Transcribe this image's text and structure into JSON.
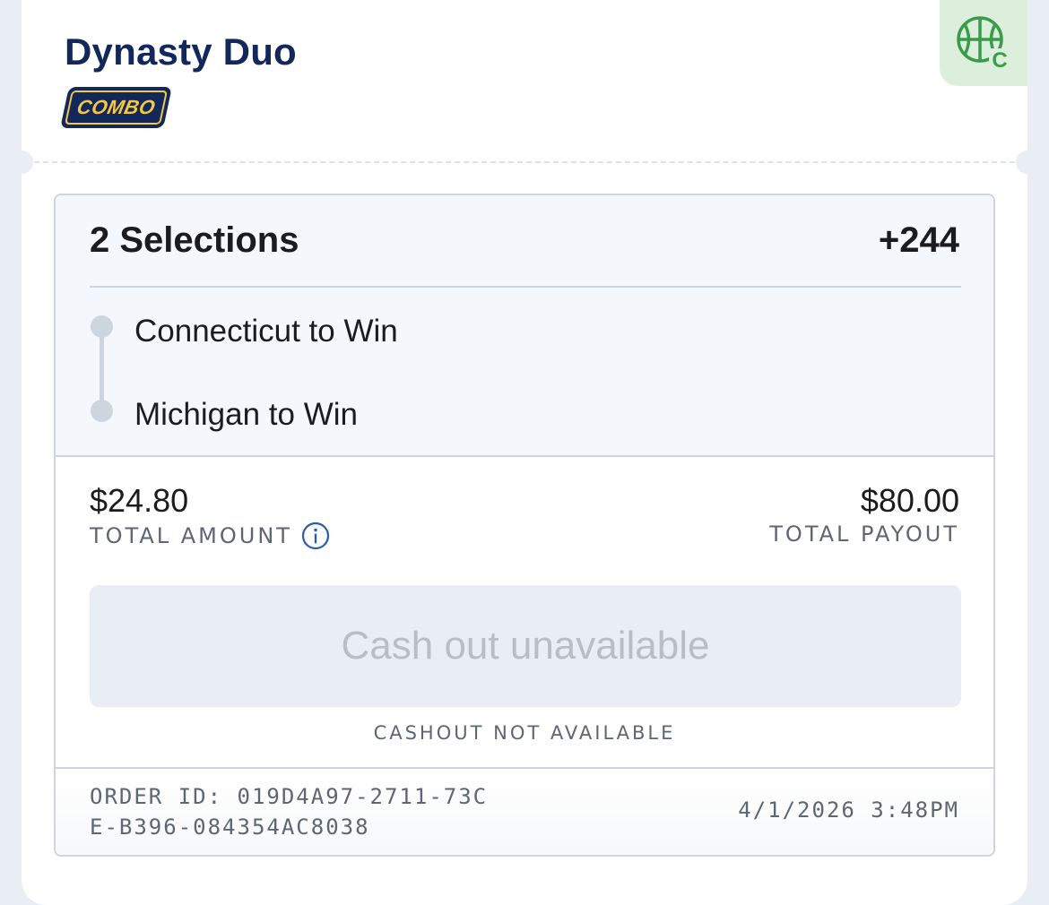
{
  "bet": {
    "title": "Dynasty Duo",
    "badge": "COMBO",
    "sport_badge_letter": "C",
    "sport_icon": "basketball-icon"
  },
  "selections": {
    "count_label": "2 Selections",
    "odds": "+244",
    "legs": [
      {
        "label": "Connecticut to Win"
      },
      {
        "label": "Michigan to Win"
      }
    ]
  },
  "totals": {
    "amount": "$24.80",
    "amount_label": "TOTAL AMOUNT",
    "payout": "$80.00",
    "payout_label": "TOTAL PAYOUT"
  },
  "cashout": {
    "button_label": "Cash out unavailable",
    "note": "CASHOUT NOT AVAILABLE"
  },
  "footer": {
    "order_id": "ORDER ID: 019D4A97-2711-73CE-B396-084354AC8038",
    "timestamp": "4/1/2026 3:48PM"
  },
  "colors": {
    "title": "#12285a",
    "badge_bg": "#12285a",
    "badge_text": "#f5c842",
    "sport_tab_bg": "#dbefdc",
    "sport_icon": "#3a9b4a",
    "info_icon": "#2a5fa8",
    "border": "#cdd5df"
  }
}
